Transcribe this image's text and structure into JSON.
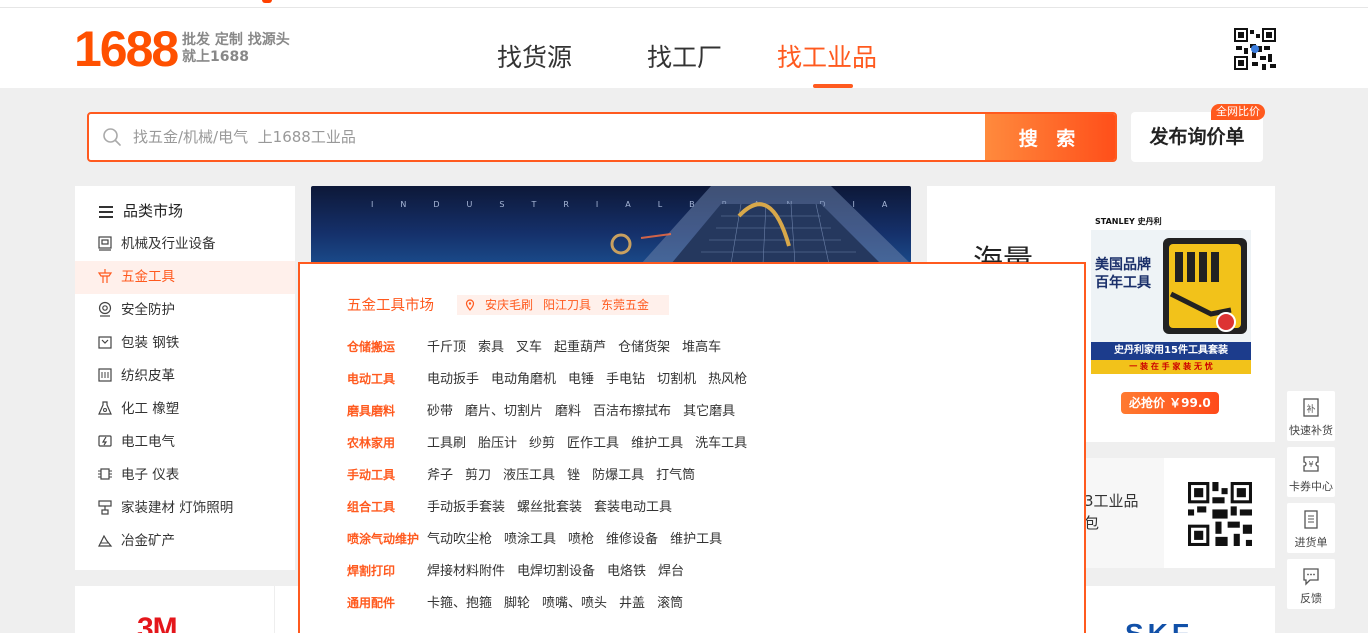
{
  "brand": {
    "logo": "1688",
    "slogan_line1": "批发 定制 找源头",
    "slogan_line2": "就上1688"
  },
  "nav": {
    "items": [
      {
        "label": "找货源",
        "active": false
      },
      {
        "label": "找工厂",
        "active": false
      },
      {
        "label": "找工业品",
        "active": true
      }
    ]
  },
  "search": {
    "placeholder": "找五金/机械/电气  上1688工业品",
    "button_label": "搜 索"
  },
  "rfq": {
    "label": "发布询价单",
    "badge": "全网比价"
  },
  "sidebar": {
    "title": "品类市场",
    "items": [
      {
        "label": "机械及行业设备",
        "icon": "machine-icon"
      },
      {
        "label": "五金工具",
        "icon": "hardware-tool-icon",
        "active": true
      },
      {
        "label": "安全防护",
        "icon": "safety-icon"
      },
      {
        "label": "包装  钢铁",
        "icon": "package-icon"
      },
      {
        "label": "纺织皮革",
        "icon": "textile-icon"
      },
      {
        "label": "化工  橡塑",
        "icon": "chemical-icon"
      },
      {
        "label": "电工电气",
        "icon": "electrical-icon"
      },
      {
        "label": "电子  仪表",
        "icon": "chip-icon"
      },
      {
        "label": "家装建材  灯饰照明",
        "icon": "home-building-icon"
      },
      {
        "label": "冶金矿产",
        "icon": "mining-icon"
      }
    ]
  },
  "banner": {
    "letters": "INDUSTRIALBRANDIANC"
  },
  "promo": {
    "title": "海量",
    "product_brand": "STANLEY 史丹利",
    "product_headline_1": "美国品牌",
    "product_headline_2": "百年工具",
    "product_bar": "史丹利家用15件工具套装",
    "product_sub": "一 装 在 手 家 装 无 忧",
    "price_label": "必抢价 ￥99.0"
  },
  "promo2": {
    "line1": "3工业品",
    "line2": "包"
  },
  "brands": {
    "left": "3M",
    "right": "SKF"
  },
  "sidetools": [
    {
      "label": "快速补货",
      "icon": "restock-icon"
    },
    {
      "label": "卡券中心",
      "icon": "coupon-icon"
    },
    {
      "label": "进货单",
      "icon": "order-list-icon"
    },
    {
      "label": "反馈",
      "icon": "feedback-icon"
    }
  ],
  "panel": {
    "title": "五金工具市场",
    "tags": [
      "安庆毛刷",
      "阳江刀具",
      "东莞五金"
    ],
    "rows": [
      {
        "label": "仓储搬运",
        "links": [
          "千斤顶",
          "索具",
          "叉车",
          "起重葫芦",
          "仓储货架",
          "堆高车"
        ]
      },
      {
        "label": "电动工具",
        "links": [
          "电动扳手",
          "电动角磨机",
          "电锤",
          "手电钻",
          "切割机",
          "热风枪"
        ]
      },
      {
        "label": "磨具磨料",
        "links": [
          "砂带",
          "磨片、切割片",
          "磨料",
          "百洁布擦拭布",
          "其它磨具"
        ]
      },
      {
        "label": "农林家用",
        "links": [
          "工具刷",
          "胎压计",
          "纱剪",
          "匠作工具",
          "维护工具",
          "洗车工具"
        ]
      },
      {
        "label": "手动工具",
        "links": [
          "斧子",
          "剪刀",
          "液压工具",
          "锉",
          "防爆工具",
          "打气筒"
        ]
      },
      {
        "label": "组合工具",
        "links": [
          "手动扳手套装",
          "螺丝批套装",
          "套装电动工具"
        ]
      },
      {
        "label": "喷涂气动维护",
        "links": [
          "气动吹尘枪",
          "喷涂工具",
          "喷枪",
          "维修设备",
          "维护工具"
        ]
      },
      {
        "label": "焊割打印",
        "links": [
          "焊接材料附件",
          "电焊切割设备",
          "电烙铁",
          "焊台"
        ]
      },
      {
        "label": "通用配件",
        "links": [
          "卡箍、抱箍",
          "脚轮",
          "喷嘴、喷头",
          "井盖",
          "滚筒"
        ]
      }
    ]
  },
  "colors": {
    "accent": "#ff5a1f",
    "background": "#efefef"
  }
}
